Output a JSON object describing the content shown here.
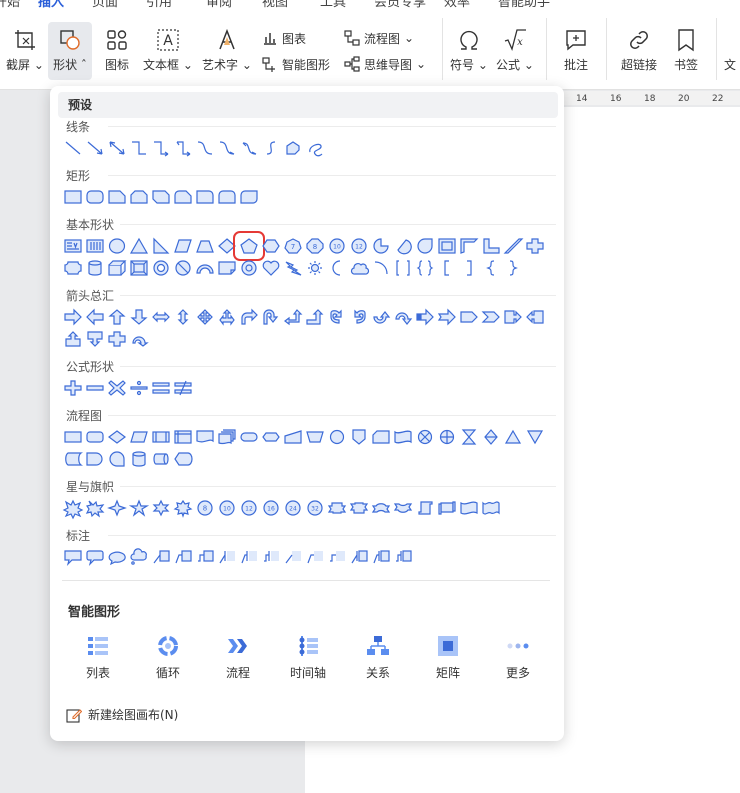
{
  "menu": {
    "tabs": [
      "开始",
      "插入",
      "页面",
      "引用",
      "审阅",
      "视图",
      "工具",
      "会员专享",
      "效率",
      "智能助手"
    ],
    "active_tab": "插入"
  },
  "ribbon": {
    "screenshot": "截屏",
    "shapes": "形状",
    "icons": "图标",
    "textbox": "文本框",
    "wordart": "艺术字",
    "chart": "图表",
    "smartart": "智能图形",
    "flowchart": "流程图",
    "mindmap": "思维导图",
    "symbol": "符号",
    "formula": "公式",
    "comment": "批注",
    "hyperlink": "超链接",
    "bookmark": "书签",
    "more_cut": "文"
  },
  "ruler": [
    "14",
    "16",
    "18",
    "20",
    "22"
  ],
  "panel": {
    "preset": "预设",
    "sections": {
      "lines": "线条",
      "rect": "矩形",
      "basic": "基本形状",
      "arrows": "箭头总汇",
      "formula": "公式形状",
      "flow": "流程图",
      "stars": "星与旗帜",
      "callouts": "标注"
    },
    "smart_title": "智能图形",
    "smart": {
      "list": "列表",
      "cycle": "循环",
      "process": "流程",
      "timeline": "时间轴",
      "relation": "关系",
      "matrix": "矩阵",
      "more": "更多"
    },
    "new_canvas": "新建绘图画布(N)",
    "colors": {
      "shape_stroke": "#3c6bd7",
      "shape_fill": "#dfe9fb",
      "highlight": "#e53935"
    }
  }
}
